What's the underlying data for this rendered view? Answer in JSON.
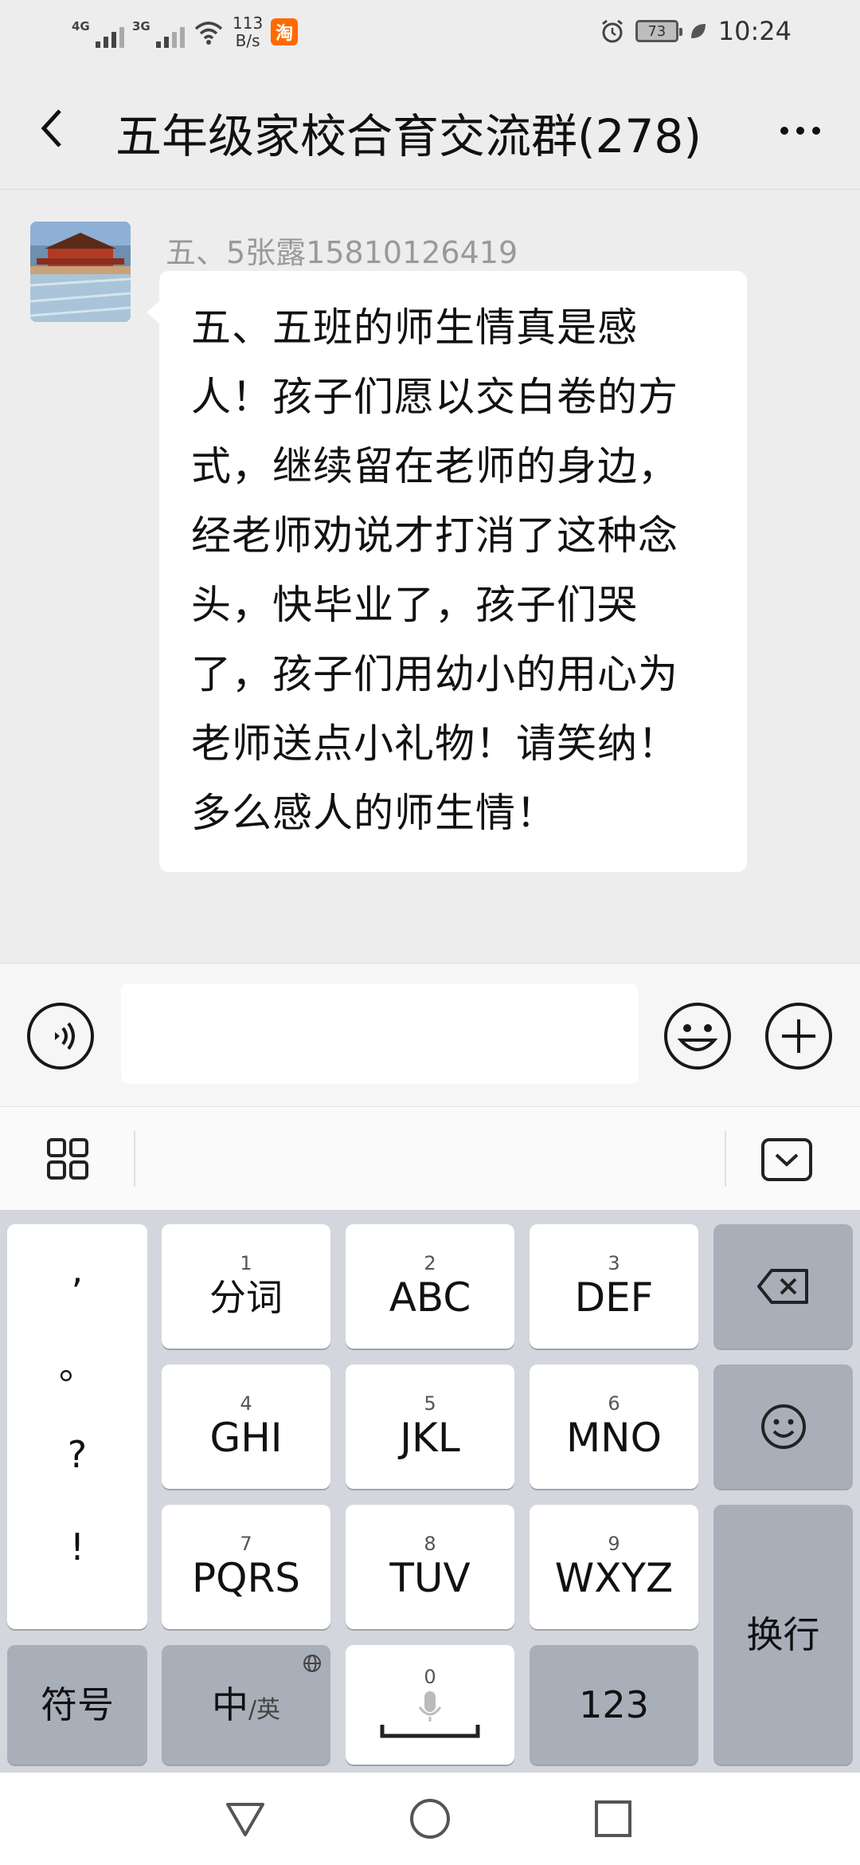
{
  "status_bar": {
    "network1": "4G",
    "network2": "3G",
    "speed_value": "113",
    "speed_unit": "B/s",
    "taobao_badge": "淘",
    "battery": "73",
    "time": "10:24"
  },
  "header": {
    "title": "五年级家校合育交流群(278)"
  },
  "message": {
    "sender": "五、5张露15810126419",
    "text": "五、五班的师生情真是感人！孩子们愿以交白卷的方式，继续留在老师的身边，经老师劝说才打消了这种念头，快毕业了，孩子们哭了，孩子们用幼小的用心为老师送点小礼物！请笑纳！多么感人的师生情！"
  },
  "input": {
    "placeholder": ""
  },
  "keyboard": {
    "punct": [
      ",",
      "。",
      "?",
      "!"
    ],
    "keys": [
      {
        "num": "1",
        "label": "分词"
      },
      {
        "num": "2",
        "label": "ABC"
      },
      {
        "num": "3",
        "label": "DEF"
      },
      {
        "num": "4",
        "label": "GHI"
      },
      {
        "num": "5",
        "label": "JKL"
      },
      {
        "num": "6",
        "label": "MNO"
      },
      {
        "num": "7",
        "label": "PQRS"
      },
      {
        "num": "8",
        "label": "TUV"
      },
      {
        "num": "9",
        "label": "WXYZ"
      }
    ],
    "symbols": "符号",
    "lang_main": "中",
    "lang_alt": "/英",
    "space_num": "0",
    "numbers": "123",
    "enter": "换行"
  }
}
